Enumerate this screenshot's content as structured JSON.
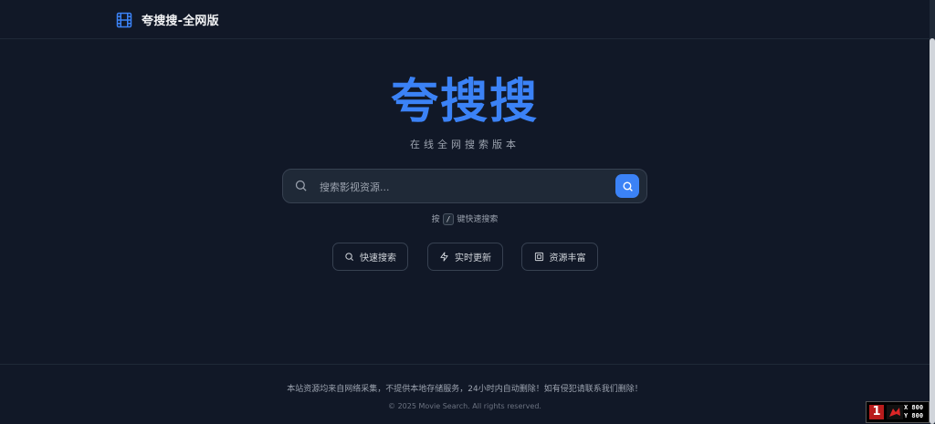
{
  "header": {
    "title": "夸搜搜-全网版",
    "icon": "film-icon"
  },
  "hero": {
    "title": "夸搜搜",
    "subtitle": "在线全网搜索版本"
  },
  "search": {
    "placeholder": "搜索影视资源...",
    "value": ""
  },
  "hint": {
    "prefix": "按",
    "key": "/",
    "suffix": "键快速搜索"
  },
  "features": [
    {
      "label": "快速搜索",
      "icon": "search-icon"
    },
    {
      "label": "实时更新",
      "icon": "lightning-icon"
    },
    {
      "label": "资源丰富",
      "icon": "box-icon"
    }
  ],
  "footer": {
    "disclaimer": "本站资源均来自网络采集，不提供本地存储服务，24小时内自动删除！如有侵犯请联系我们删除！",
    "copyright": "© 2025 Movie Search. All rights reserved."
  },
  "overlay": {
    "badge": "1",
    "x_label": "X 800",
    "y_label": "Y 800"
  },
  "colors": {
    "background": "#111827",
    "accent": "#3b82f6",
    "surface": "#1f2937",
    "border": "#374151"
  }
}
